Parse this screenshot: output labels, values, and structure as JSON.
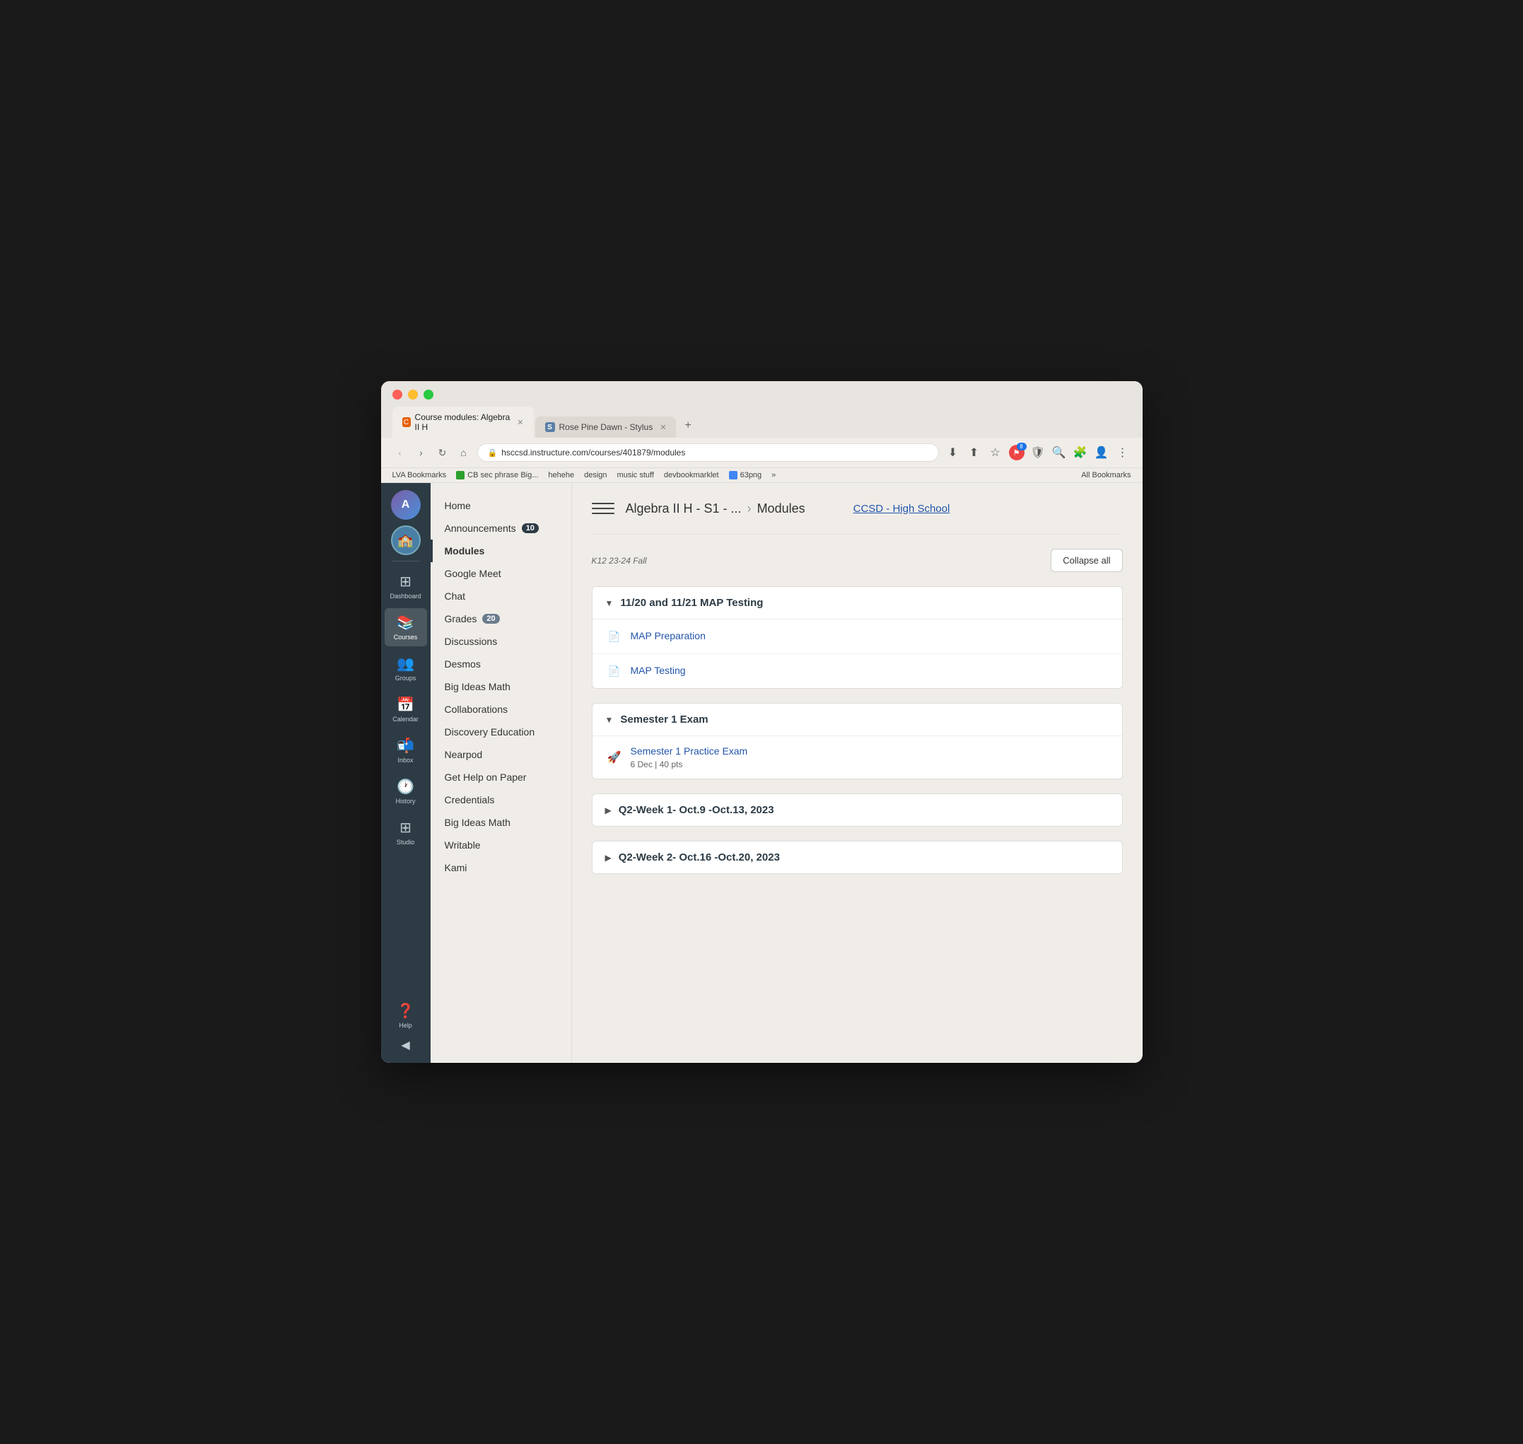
{
  "browser": {
    "tabs": [
      {
        "id": "tab1",
        "label": "Course modules: Algebra II H",
        "icon_type": "canvas",
        "icon_text": "C",
        "active": true
      },
      {
        "id": "tab2",
        "label": "Rose Pine Dawn - Stylus",
        "icon_type": "stylus",
        "icon_text": "S",
        "active": false
      }
    ],
    "new_tab_label": "+",
    "address": "hsccsd.instructure.com/courses/401879/modules",
    "badge_number": "8",
    "bookmarks": [
      "LVA Bookmarks",
      "CB sec phrase Big...",
      "hehehe",
      "design",
      "music stuff",
      "devbookmarklet",
      "63png"
    ],
    "bookmarks_more": "»",
    "bookmarks_all": "All Bookmarks"
  },
  "canvas_sidebar": {
    "avatar_initials": "A",
    "nav_items": [
      {
        "id": "dashboard",
        "icon": "⊞",
        "label": "Dashboard"
      },
      {
        "id": "courses",
        "icon": "📚",
        "label": "Courses",
        "active": true
      },
      {
        "id": "groups",
        "icon": "👥",
        "label": "Groups"
      },
      {
        "id": "calendar",
        "icon": "📅",
        "label": "Calendar"
      },
      {
        "id": "inbox",
        "icon": "📬",
        "label": "Inbox"
      },
      {
        "id": "history",
        "icon": "🕐",
        "label": "History"
      },
      {
        "id": "studio",
        "icon": "⊞",
        "label": "Studio"
      },
      {
        "id": "help",
        "icon": "?",
        "label": "Help"
      }
    ],
    "collapse_icon": "◀"
  },
  "course_nav": {
    "items": [
      {
        "id": "home",
        "label": "Home"
      },
      {
        "id": "announcements",
        "label": "Announcements",
        "badge": "10"
      },
      {
        "id": "modules",
        "label": "Modules",
        "active": true
      },
      {
        "id": "google_meet",
        "label": "Google Meet"
      },
      {
        "id": "chat",
        "label": "Chat"
      },
      {
        "id": "grades",
        "label": "Grades",
        "badge": "20"
      },
      {
        "id": "discussions",
        "label": "Discussions"
      },
      {
        "id": "desmos",
        "label": "Desmos"
      },
      {
        "id": "big_ideas_math_1",
        "label": "Big Ideas Math"
      },
      {
        "id": "collaborations",
        "label": "Collaborations"
      },
      {
        "id": "discovery_ed",
        "label": "Discovery Education"
      },
      {
        "id": "nearpod",
        "label": "Nearpod"
      },
      {
        "id": "get_help",
        "label": "Get Help on Paper"
      },
      {
        "id": "credentials",
        "label": "Credentials"
      },
      {
        "id": "big_ideas_math_2",
        "label": "Big Ideas Math"
      },
      {
        "id": "writable",
        "label": "Writable"
      },
      {
        "id": "kami",
        "label": "Kami"
      }
    ]
  },
  "main": {
    "hamburger_label": "☰",
    "course_name": "Algebra II H - S1 - ...",
    "page_label": "Modules",
    "ccsd_link": "CCSD - High School",
    "meta_label": "K12 23-24 Fall",
    "collapse_all_btn": "Collapse all",
    "modules": [
      {
        "id": "map_testing",
        "title": "11/20 and 11/21 MAP Testing",
        "expanded": true,
        "items": [
          {
            "id": "map_prep",
            "icon": "📄",
            "type": "doc",
            "title": "MAP Preparation",
            "link": true
          },
          {
            "id": "map_test",
            "icon": "📄",
            "type": "doc",
            "title": "MAP Testing",
            "link": true
          }
        ]
      },
      {
        "id": "semester_exam",
        "title": "Semester 1 Exam",
        "expanded": true,
        "items": [
          {
            "id": "sem1_practice",
            "icon": "🚀",
            "type": "rocket",
            "title": "Semester 1 Practice Exam",
            "link": true,
            "meta": "6 Dec  |  40 pts"
          }
        ]
      },
      {
        "id": "q2_week1",
        "title": "Q2-Week 1- Oct.9 -Oct.13, 2023",
        "expanded": false,
        "items": []
      },
      {
        "id": "q2_week2",
        "title": "Q2-Week 2- Oct.16 -Oct.20, 2023",
        "expanded": false,
        "items": []
      }
    ]
  }
}
